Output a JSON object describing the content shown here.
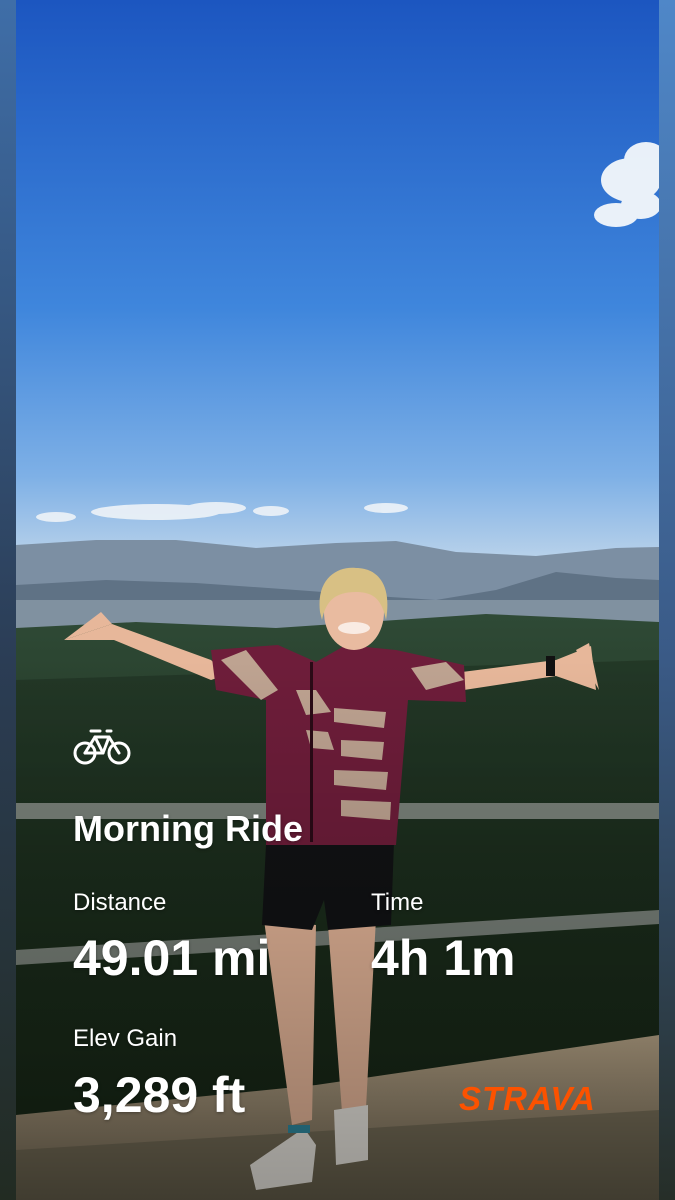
{
  "activity": {
    "sport_icon": "bicycle-icon",
    "title": "Morning Ride"
  },
  "stats": {
    "distance": {
      "label": "Distance",
      "value": "49.01 mi"
    },
    "time": {
      "label": "Time",
      "value": "4h 1m"
    },
    "elevation": {
      "label": "Elev Gain",
      "value": "3,289 ft"
    }
  },
  "brand": {
    "name": "STRAVA",
    "color": "#fc5200"
  },
  "scene": {
    "sky_top_color": "#1f5fc8",
    "sky_horizon_color": "#9cc0e6",
    "forest_color": "#24351f",
    "jersey_color": "#6e1d3a"
  }
}
